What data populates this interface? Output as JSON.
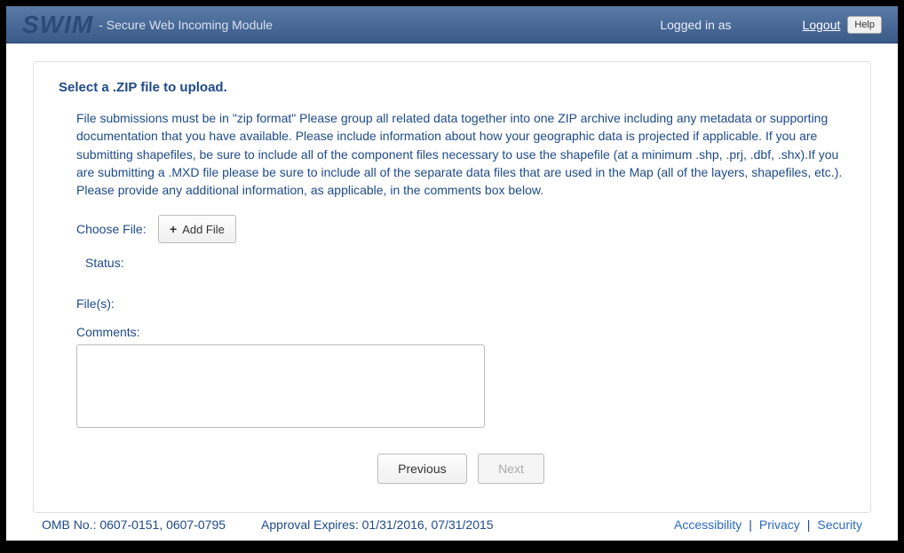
{
  "header": {
    "logo": "SWIM",
    "subtitle": "- Secure Web Incoming Module",
    "logged_in_text": "Logged in as",
    "logout_label": "Logout",
    "help_label": "Help"
  },
  "main": {
    "title": "Select a .ZIP file to upload.",
    "instructions": "File submissions must be in \"zip format\" Please group all related data together into one ZIP archive including any metadata or supporting documentation that you have available. Please include information about how your geographic data is projected if applicable. If you are submitting shapefiles, be sure to include all of the component files necessary to use the shapefile (at a minimum .shp, .prj, .dbf, .shx).If you are submitting a .MXD file please be sure to include all of the separate data files that are used in the Map (all of the layers, shapefiles, etc.). Please provide any additional information, as applicable, in the comments box below.",
    "choose_file_label": "Choose File:",
    "add_file_label": "Add File",
    "status_label": "Status:",
    "status_value": "",
    "files_label": "File(s):",
    "comments_label": "Comments:",
    "comments_value": "",
    "previous_label": "Previous",
    "next_label": "Next"
  },
  "footer": {
    "omb_text": "OMB No.: 0607-0151, 0607-0795",
    "approval_text": "Approval Expires: 01/31/2016, 07/31/2015",
    "accessibility_label": "Accessibility",
    "privacy_label": "Privacy",
    "security_label": "Security"
  }
}
